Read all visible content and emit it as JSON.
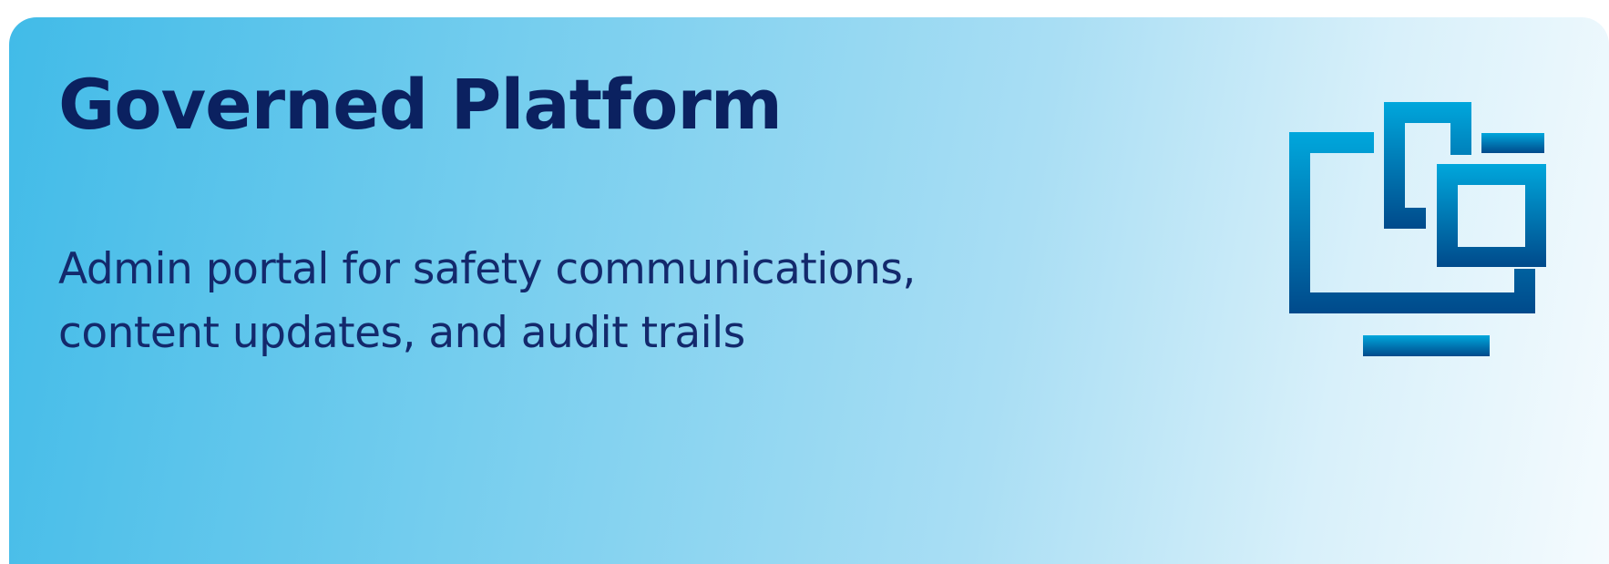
{
  "card": {
    "title": "Governed Platform",
    "description": "Admin portal for safety communications, content updates, and audit trails",
    "icon": "monitor-windows-icon"
  },
  "colors": {
    "title_text": "#0b2160",
    "body_text": "#13296c",
    "gradient_start": "#41bbe8",
    "gradient_end": "#f5fbfe",
    "icon_top": "#00a7dc",
    "icon_bottom": "#004a8b"
  }
}
